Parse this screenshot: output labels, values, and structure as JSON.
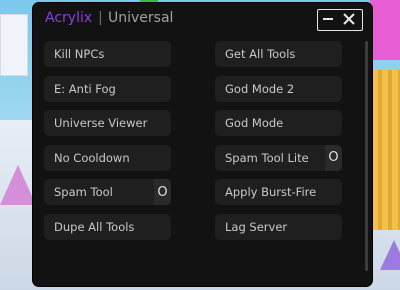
{
  "app": {
    "brand": "Acrylix",
    "separator": "|",
    "subtitle": "Universal"
  },
  "window_controls": {
    "minimize": "—",
    "close": "✕"
  },
  "left_column": [
    {
      "label": "Kill NPCs"
    },
    {
      "label": "E: Anti Fog"
    },
    {
      "label": "Universe Viewer"
    },
    {
      "label": "No Cooldown"
    },
    {
      "label": "Spam Tool",
      "toggle": "O"
    },
    {
      "label": "Dupe All Tools"
    }
  ],
  "right_column": [
    {
      "label": "Get All Tools"
    },
    {
      "label": "God Mode 2"
    },
    {
      "label": "God Mode"
    },
    {
      "label": "Spam Tool Lite",
      "toggle": "O"
    },
    {
      "label": "Apply Burst-Fire"
    },
    {
      "label": "Lag Server"
    }
  ],
  "colors": {
    "accent": "#8a3fd6",
    "panel": "#121212",
    "button": "#1f1f1f"
  }
}
